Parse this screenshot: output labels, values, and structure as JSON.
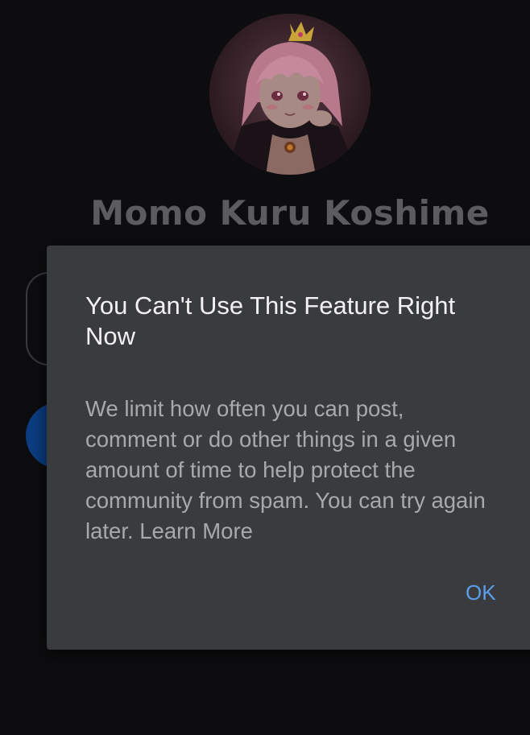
{
  "profile": {
    "name": "Momo Kuru Koshime",
    "avatar_icon": "profile-avatar-anime-character"
  },
  "dialog": {
    "title": "You Can't Use This Feature Right Now",
    "body": "We limit how often you can post, comment or do other things in a given amount of time to help protect the community from spam. You can try again later.",
    "learn_more": "Learn More",
    "ok_label": "OK"
  },
  "colors": {
    "background": "#0d0d0f",
    "dialog_background": "#3a3b3e",
    "title_text": "#f2f2f2",
    "body_text": "#a8a9ab",
    "accent": "#5b9ee8",
    "dim_blue_button": "#0b3d80"
  }
}
